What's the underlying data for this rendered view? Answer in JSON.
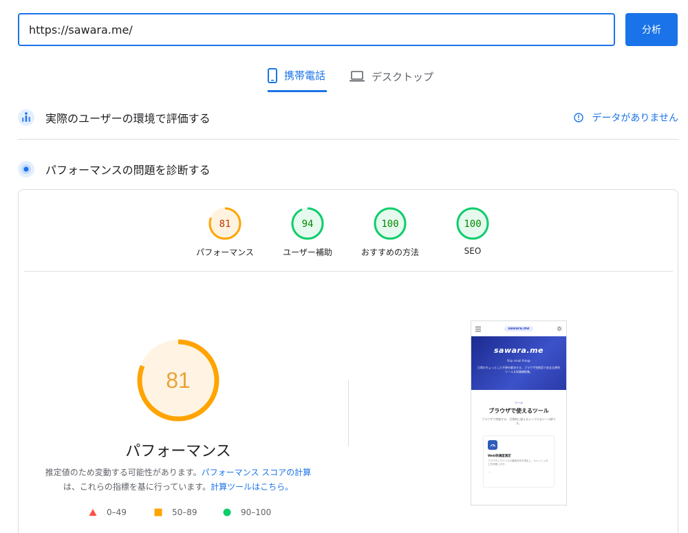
{
  "url_bar": {
    "value": "https://sawara.me/",
    "analyze_label": "分析"
  },
  "tabs": {
    "mobile": "携帯電話",
    "desktop": "デスクトップ"
  },
  "field_data": {
    "title": "実際のユーザーの環境で評価する",
    "no_data": "データがありません"
  },
  "diagnose": {
    "title": "パフォーマンスの問題を診断する"
  },
  "scores": [
    {
      "label": "パフォーマンス",
      "value": "81",
      "color": "#ffa400"
    },
    {
      "label": "ユーザー補助",
      "value": "94",
      "color": "#0cce6b"
    },
    {
      "label": "おすすめの方法",
      "value": "100",
      "color": "#0cce6b"
    },
    {
      "label": "SEO",
      "value": "100",
      "color": "#0cce6b"
    }
  ],
  "main": {
    "score": "81",
    "label": "パフォーマンス",
    "desc_text1": "推定値のため変動する可能性があります。",
    "desc_link1": "パフォーマンス スコアの計算",
    "desc_text2": "は、これらの指標を基に行っています。",
    "desc_link2": "計算ツールはこちら。"
  },
  "legend": [
    {
      "range": "0–49",
      "color": "#ff4e42"
    },
    {
      "range": "50–89",
      "color": "#ffa400"
    },
    {
      "range": "90–100",
      "color": "#0cce6b"
    }
  ],
  "thumbnail": {
    "logo": "sawara.me",
    "brand": "sawara.me",
    "tagline": "Ship small things",
    "hero_desc": "日常のちょっとした不便を解決する、ブラウザ完結型で安全な便利ツール＆知識補助集。",
    "section_tag": "ツール",
    "section_title": "ブラウザで使えるツール",
    "section_desc": "ブラウザで完結する、日常的に使えるシンプルなツール群です。",
    "card_title": "Web快適度測定",
    "card_desc": "ブラウザとデバイスの通信状況を測定し、キャッシュなどを評価します。",
    "card_more": "..."
  }
}
